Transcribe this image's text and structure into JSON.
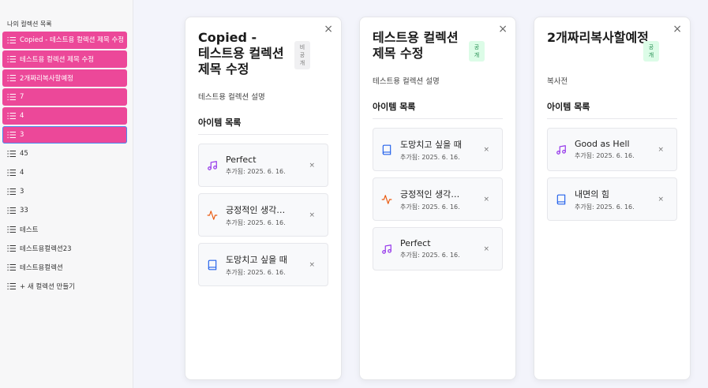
{
  "sidebar": {
    "title": "나의 컬렉션 목록",
    "items": [
      {
        "label": "Copied - 테스트용 컬렉션 제목 수정",
        "active": true
      },
      {
        "label": "테스트용 컬렉션 제목 수정",
        "active": true
      },
      {
        "label": "2개짜리복사할예정",
        "active": true
      },
      {
        "label": "7",
        "active": true
      },
      {
        "label": "4",
        "active": true
      },
      {
        "label": "3",
        "active": true,
        "selected": true
      },
      {
        "label": "45",
        "active": false
      },
      {
        "label": "4",
        "active": false
      },
      {
        "label": "3",
        "active": false
      },
      {
        "label": "33",
        "active": false
      },
      {
        "label": "테스트",
        "active": false
      },
      {
        "label": "테스트용컬렉션23",
        "active": false
      },
      {
        "label": "테스트용컬렉션",
        "active": false
      },
      {
        "label": "+ 새 컬렉션 만들기",
        "active": false
      }
    ]
  },
  "cards": [
    {
      "title": "Copied - 테스트용 컬렉션 제목 수정",
      "badge": "비공개",
      "badge_type": "private",
      "description": "테스트용 컬렉션 설명",
      "items_header": "아이템 목록",
      "close": "×",
      "items": [
        {
          "icon": "music-icon",
          "title": "Perfect",
          "date": "추가됨: 2025. 6. 16.",
          "remove": "×"
        },
        {
          "icon": "activity-icon",
          "title": "긍정적인 생각의 힘",
          "date": "추가됨: 2025. 6. 16.",
          "remove": "×"
        },
        {
          "icon": "book-icon",
          "title": "도망치고 싶을 때",
          "date": "추가됨: 2025. 6. 16.",
          "remove": "×"
        }
      ]
    },
    {
      "title": "테스트용 컬렉션 제목 수정",
      "badge": "공개",
      "badge_type": "public",
      "description": "테스트용 컬렉션 설명",
      "items_header": "아이템 목록",
      "close": "×",
      "items": [
        {
          "icon": "book-icon",
          "title": "도망치고 싶을 때",
          "date": "추가됨: 2025. 6. 16.",
          "remove": "×"
        },
        {
          "icon": "activity-icon",
          "title": "긍정적인 생각의 힘",
          "date": "추가됨: 2025. 6. 16.",
          "remove": "×"
        },
        {
          "icon": "music-icon",
          "title": "Perfect",
          "date": "추가됨: 2025. 6. 16.",
          "remove": "×"
        }
      ]
    },
    {
      "title": "2개짜리복사할예정",
      "badge": "공개",
      "badge_type": "public",
      "description": "복사전",
      "items_header": "아이템 목록",
      "close": "×",
      "items": [
        {
          "icon": "music-icon",
          "title": "Good as Hell",
          "date": "추가됨: 2025. 6. 16.",
          "remove": "×"
        },
        {
          "icon": "book-icon",
          "title": "내면의 힘",
          "date": "추가됨: 2025. 6. 16.",
          "remove": "×"
        }
      ]
    }
  ],
  "colors": {
    "active_item": "#ec4899",
    "selected_outline": "#4a8af0",
    "music_icon": "#9333ea",
    "activity_icon": "#ea580c",
    "book_icon": "#2563eb"
  }
}
